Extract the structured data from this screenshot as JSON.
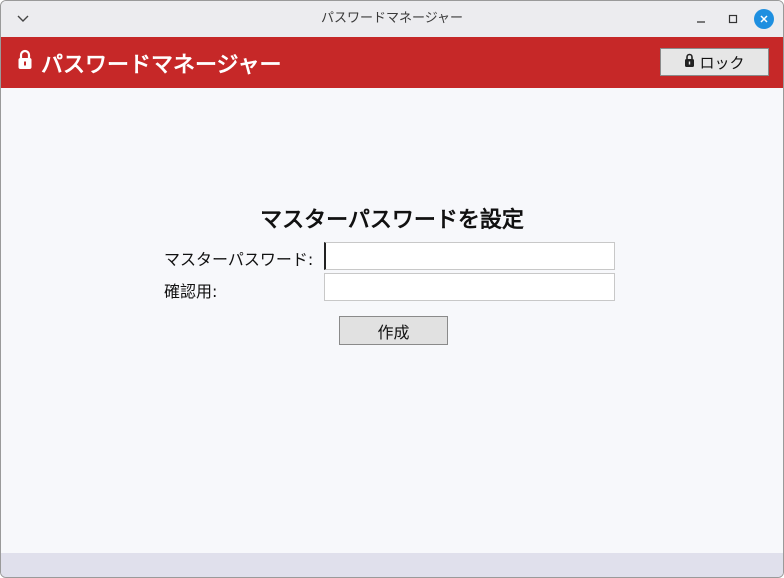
{
  "window": {
    "title": "パスワードマネージャー"
  },
  "header": {
    "app_title": "パスワードマネージャー",
    "lock_label": "ロック",
    "background_color": "#c62828"
  },
  "setup_form": {
    "heading": "マスターパスワードを設定",
    "master_password_label": "マスターパスワード:",
    "master_password_value": "",
    "confirm_label": "確認用:",
    "confirm_value": "",
    "create_label": "作成"
  },
  "icons": {
    "window_menu": "chevron-down-icon",
    "minimize": "minimize-icon",
    "maximize": "maximize-icon",
    "close": "close-icon",
    "brand": "lock-icon",
    "lock_button": "lock-icon"
  },
  "colors": {
    "accent": "#c62828",
    "close_button": "#1e8fe0"
  }
}
